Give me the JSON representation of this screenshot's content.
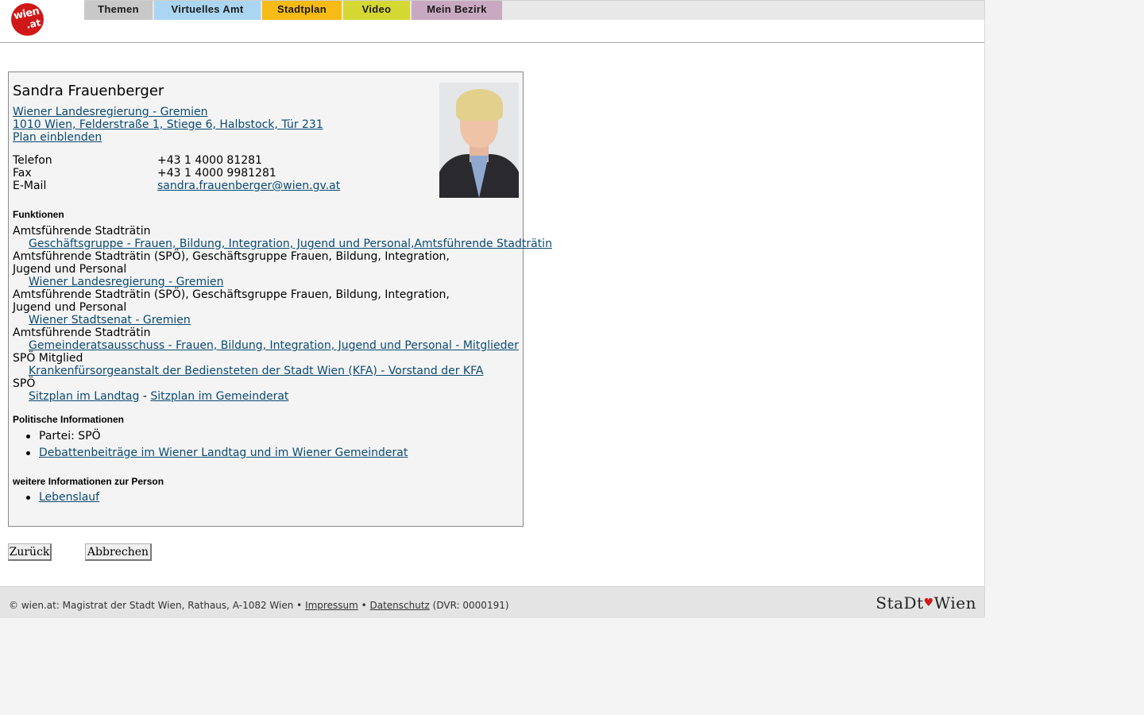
{
  "nav": {
    "tabs": [
      "Themen",
      "Virtuelles Amt",
      "Stadtplan",
      "Video",
      "Mein Bezirk"
    ],
    "logo_text_top": "wien",
    "logo_text_bottom": ".at"
  },
  "person": {
    "name": "Sandra Frauenberger",
    "org_link": "Wiener Landesregierung - Gremien ",
    "address_link": "1010 Wien, Felderstraße 1, Stiege 6, Halbstock, Tür 231",
    "plan_link": "Plan einblenden",
    "contact": {
      "phone_label": "Telefon",
      "phone": "+43 1 4000 81281",
      "fax_label": "Fax",
      "fax": "+43 1 4000 9981281",
      "email_label": "E-Mail",
      "email": "sandra.frauenberger@wien.gv.at"
    }
  },
  "functions": {
    "heading": "Funktionen",
    "items": [
      {
        "role": "Amtsführende Stadträtin",
        "link": "Geschäftsgruppe - Frauen, Bildung, Integration, Jugend und Personal,Amtsführende Stadträtin"
      },
      {
        "role": "Amtsführende Stadträtin (SPÖ), Geschäftsgruppe Frauen, Bildung, Integration, Jugend und Personal",
        "link": "Wiener Landesregierung - Gremien"
      },
      {
        "role": "Amtsführende Stadträtin (SPÖ), Geschäftsgruppe Frauen, Bildung, Integration, Jugend und Personal",
        "link": "Wiener Stadtsenat - Gremien"
      },
      {
        "role": "Amtsführende Stadträtin",
        "link": "Gemeinderatsausschuss - Frauen, Bildung, Integration, Jugend und Personal - Mitglieder"
      },
      {
        "role": "SPÖ Mitglied",
        "link": "Krankenfürsorgeanstalt der Bediensteten der Stadt Wien (KFA) - Vorstand der KFA"
      },
      {
        "role": "SPÖ"
      }
    ],
    "seat_link_1": "Sitzplan im Landtag",
    "seat_sep": " - ",
    "seat_link_2": "Sitzplan im Gemeinderat"
  },
  "political": {
    "heading": "Politische Informationen",
    "party": "Partei: SPÖ",
    "debate_link": "Debattenbeiträge im Wiener Landtag und im Wiener Gemeinderat"
  },
  "more": {
    "heading": "weitere Informationen zur Person",
    "cv_link": "Lebenslauf"
  },
  "buttons": {
    "back": "Zurück",
    "cancel": "Abbrechen"
  },
  "footer": {
    "text": "© wien.at: Magistrat der Stadt Wien, Rathaus, A-1082 Wien • ",
    "impressum": "Impressum",
    "sep": " • ",
    "datenschutz": "Datenschutz",
    "dvr": " (DVR: 0000191)",
    "brand_left": "StaDt",
    "brand_right": "Wien"
  },
  "colors": {
    "link": "#0b4a73",
    "tab_themen": "#c8c8c8",
    "tab_amt": "#abd6f2",
    "tab_stadtplan": "#f7bb16",
    "tab_video": "#d5d832",
    "tab_bezirk": "#c9a9c2",
    "logo_red": "#d01818"
  }
}
